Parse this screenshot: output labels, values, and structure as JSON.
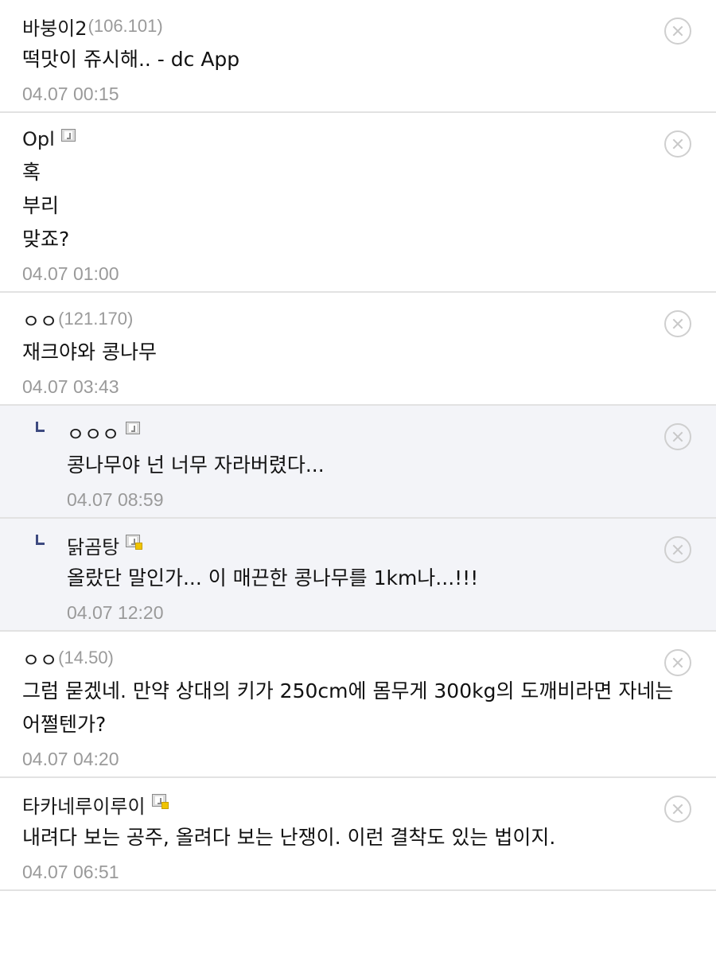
{
  "comments": [
    {
      "nick": "바붕이2",
      "ip": "(106.101)",
      "gallog_icon": "none",
      "is_reply": false,
      "lines": [
        "떡맛이 쥬시해.. - dc App"
      ],
      "time": "04.07 00:15"
    },
    {
      "nick": "Opl",
      "ip": "",
      "gallog_icon": "fixed-nick-icon",
      "is_reply": false,
      "lines": [
        "혹",
        "부리",
        "맞죠?"
      ],
      "time": "04.07 01:00"
    },
    {
      "nick": "ㅇㅇ",
      "ip": "(121.170)",
      "gallog_icon": "none",
      "is_reply": false,
      "lines": [
        "재크야와 콩나무"
      ],
      "time": "04.07 03:43"
    },
    {
      "nick": "ㅇㅇㅇ",
      "ip": "",
      "gallog_icon": "fixed-nick-icon",
      "is_reply": true,
      "lines": [
        "콩나무야 넌 너무 자라버렸다..."
      ],
      "time": "04.07 08:59"
    },
    {
      "nick": "닭곰탕",
      "ip": "",
      "gallog_icon": "semi-fixed-nick-icon",
      "is_reply": true,
      "lines": [
        "올랐단 말인가... 이 매끈한 콩나무를 1km나...!!!"
      ],
      "time": "04.07 12:20"
    },
    {
      "nick": "ㅇㅇ",
      "ip": "(14.50)",
      "gallog_icon": "none",
      "is_reply": false,
      "lines": [
        "그럼 묻겠네. 만약 상대의 키가 250cm에 몸무게 300kg의 도깨비라면 자네는",
        "어쩔텐가?"
      ],
      "time": "04.07 04:20"
    },
    {
      "nick": "타카네루이루이",
      "ip": "",
      "gallog_icon": "semi-fixed-nick-icon",
      "is_reply": false,
      "lines": [
        "내려다 보는 공주, 올려다 보는 난쟁이. 이런 결착도 있는 법이지."
      ],
      "time": "04.07 06:51"
    }
  ],
  "colors": {
    "text": "#111111",
    "meta": "#9a9a9a",
    "divider": "#e2e2e2",
    "reply_bg": "#f3f4f8",
    "reply_mark": "#3d4a80",
    "semi_fixed_dot": "#f0c400"
  }
}
